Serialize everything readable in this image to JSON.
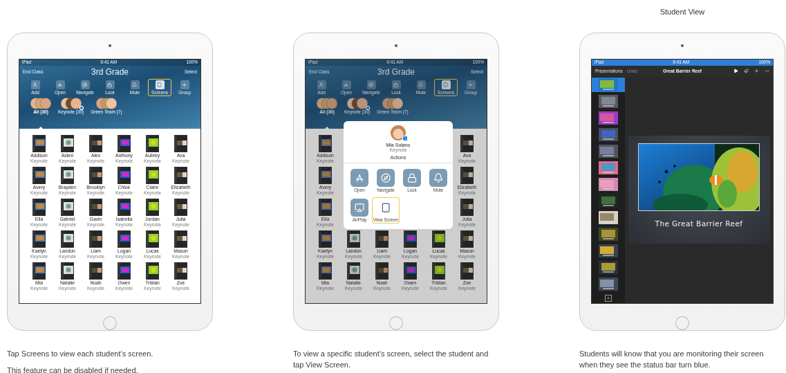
{
  "panels": [
    {
      "kind": "class",
      "dimmed": false,
      "status_bar": {
        "carrier": "iPad",
        "time": "9:41 AM",
        "battery": "100%",
        "monitored": false
      },
      "nav": {
        "left": "End Class",
        "title": "3rd Grade",
        "right": "Select"
      },
      "actions": [
        {
          "kind": "add",
          "label": "Add",
          "selected": false
        },
        {
          "kind": "open",
          "label": "Open",
          "selected": false
        },
        {
          "kind": "navigate",
          "label": "Navigate",
          "selected": false
        },
        {
          "kind": "lock",
          "label": "Lock",
          "selected": false
        },
        {
          "kind": "mute",
          "label": "Mute",
          "selected": false
        },
        {
          "kind": "screens",
          "label": "Screens",
          "selected": true
        },
        {
          "kind": "group",
          "label": "Group",
          "selected": false
        }
      ],
      "groups": [
        {
          "label": "All (30)",
          "badge": false,
          "selected": true
        },
        {
          "label": "Keynote (30)",
          "badge": true,
          "selected": false
        },
        {
          "label": "Green Team (7)",
          "badge": false,
          "selected": false
        }
      ],
      "students": [
        {
          "name": "Addison",
          "app": "Keynote"
        },
        {
          "name": "Aiden",
          "app": "Keynote"
        },
        {
          "name": "Alex",
          "app": "Keynote"
        },
        {
          "name": "Anthony",
          "app": "Keynote"
        },
        {
          "name": "Aubrey",
          "app": "Keynote"
        },
        {
          "name": "Ava",
          "app": "Keynote"
        },
        {
          "name": "Avery",
          "app": "Keynote"
        },
        {
          "name": "Brayden",
          "app": "Keynote"
        },
        {
          "name": "Brooklyn",
          "app": "Keynote"
        },
        {
          "name": "Chloe",
          "app": "Keynote"
        },
        {
          "name": "Claire",
          "app": "Keynote"
        },
        {
          "name": "Elizabeth",
          "app": "Keynote"
        },
        {
          "name": "Ella",
          "app": "Keynote"
        },
        {
          "name": "Gabriel",
          "app": "Keynote"
        },
        {
          "name": "Gavin",
          "app": "Keynote"
        },
        {
          "name": "Isabella",
          "app": "Keynote"
        },
        {
          "name": "Jordan",
          "app": "Keynote"
        },
        {
          "name": "Julia",
          "app": "Keynote"
        },
        {
          "name": "Kaelyn",
          "app": "Keynote"
        },
        {
          "name": "Landon",
          "app": "Keynote"
        },
        {
          "name": "Liam",
          "app": "Keynote"
        },
        {
          "name": "Logan",
          "app": "Keynote"
        },
        {
          "name": "Lucas",
          "app": "Keynote"
        },
        {
          "name": "Mason",
          "app": "Keynote"
        },
        {
          "name": "Mia",
          "app": "Keynote"
        },
        {
          "name": "Natalie",
          "app": "Keynote"
        },
        {
          "name": "Noah",
          "app": "Keynote"
        },
        {
          "name": "Owen",
          "app": "Keynote"
        },
        {
          "name": "Tristan",
          "app": "Keynote"
        },
        {
          "name": "Zoe",
          "app": "Keynote"
        }
      ],
      "captions": [
        "Tap Screens to view each student’s screen.",
        "This feature can be disabled if needed."
      ]
    },
    {
      "kind": "class",
      "dimmed": true,
      "status_bar": {
        "carrier": "iPad",
        "time": "9:41 AM",
        "battery": "100%",
        "monitored": false
      },
      "nav": {
        "left": "End Class",
        "title": "3rd Grade",
        "right": "Select"
      },
      "actions": [
        {
          "kind": "add",
          "label": "Add",
          "selected": false
        },
        {
          "kind": "open",
          "label": "Open",
          "selected": false
        },
        {
          "kind": "navigate",
          "label": "Navigate",
          "selected": false
        },
        {
          "kind": "lock",
          "label": "Lock",
          "selected": false
        },
        {
          "kind": "mute",
          "label": "Mute",
          "selected": false
        },
        {
          "kind": "screens",
          "label": "Screens",
          "selected": true
        },
        {
          "kind": "group",
          "label": "Group",
          "selected": false
        }
      ],
      "groups": [
        {
          "label": "All (30)",
          "badge": false,
          "selected": true
        },
        {
          "label": "Keynote (30)",
          "badge": true,
          "selected": false
        },
        {
          "label": "Green Team (7)",
          "badge": false,
          "selected": false
        }
      ],
      "students": [
        {
          "name": "Addison",
          "app": "Keynote"
        },
        {
          "name": "Ava",
          "app": "Keynote"
        },
        {
          "name": "Avery",
          "app": "Keynote"
        },
        {
          "name": "Elizabeth",
          "app": "Keynote"
        },
        {
          "name": "Ella",
          "app": "Keynote"
        },
        {
          "name": "Julia",
          "app": "Keynote"
        },
        {
          "name": "Kaelyn",
          "app": "Keynote"
        },
        {
          "name": "Landon",
          "app": "Keynote"
        },
        {
          "name": "Liam",
          "app": "Keynote"
        },
        {
          "name": "Logan",
          "app": "Keynote"
        },
        {
          "name": "Lucas",
          "app": "Keynote"
        },
        {
          "name": "Mason",
          "app": "Keynote"
        },
        {
          "name": "Mia",
          "app": "Keynote"
        },
        {
          "name": "Natalie",
          "app": "Keynote"
        },
        {
          "name": "Noah",
          "app": "Keynote"
        },
        {
          "name": "Owen",
          "app": "Keynote"
        },
        {
          "name": "Tristan",
          "app": "Keynote"
        },
        {
          "name": "Zoe",
          "app": "Keynote"
        }
      ],
      "popover": {
        "name": "Mia Solano",
        "app": "Keynote",
        "heading": "Actions",
        "actions": [
          {
            "kind": "open",
            "label": "Open",
            "selected": false
          },
          {
            "kind": "navigate",
            "label": "Navigate",
            "selected": false
          },
          {
            "kind": "lock",
            "label": "Lock",
            "selected": false
          },
          {
            "kind": "mute",
            "label": "Mute",
            "selected": false
          },
          {
            "kind": "airplay",
            "label": "AirPlay",
            "selected": false
          },
          {
            "kind": "view_screen",
            "label": "View Screen",
            "selected": true
          }
        ]
      },
      "captions": [
        "To view a specific student’s screen, select the student and tap View Screen."
      ]
    },
    {
      "kind": "keynote",
      "heading": "Student View",
      "status_bar": {
        "carrier": "iPad",
        "time": "9:41 AM",
        "battery": "100%",
        "monitored": true
      },
      "toolbar": {
        "back": "Presentations",
        "undo": "Undo",
        "undo_disabled": true,
        "title": "Great Barrier Reef"
      },
      "slides": [
        {
          "selected": true
        },
        {
          "selected": false
        },
        {
          "selected": false
        },
        {
          "selected": false
        },
        {
          "selected": false
        },
        {
          "selected": false
        },
        {
          "selected": false
        },
        {
          "selected": false
        },
        {
          "selected": false
        },
        {
          "selected": false
        },
        {
          "selected": false
        },
        {
          "selected": false
        },
        {
          "selected": false
        }
      ],
      "slide_title": "The Great Barrier Reef",
      "captions": [
        "Students will know that you are monitoring their screen when they see the status bar turn blue."
      ]
    }
  ]
}
